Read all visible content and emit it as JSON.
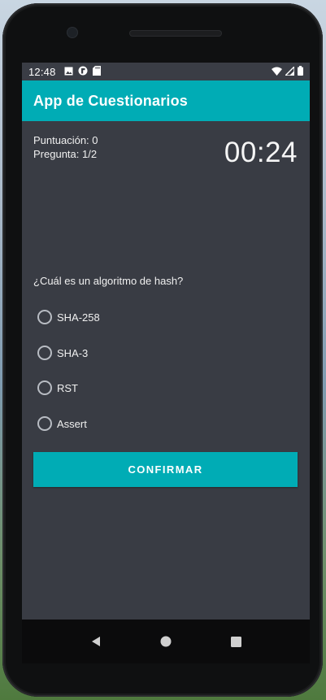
{
  "status_bar": {
    "time": "12:48",
    "left_icons": [
      "image-icon",
      "app-notification-icon",
      "sd-card-icon"
    ],
    "right_icons": [
      "wifi-icon",
      "signal-icon",
      "battery-icon"
    ]
  },
  "app_bar": {
    "title": "App de Cuestionarios"
  },
  "quiz": {
    "score_label": "Puntuación: 0",
    "question_counter": "Pregunta: 1/2",
    "timer": "00:24",
    "question": "¿Cuál es un algoritmo de hash?",
    "options": [
      "SHA-258",
      "SHA-3",
      "RST",
      "Assert"
    ],
    "confirm_label": "CONFIRMAR"
  },
  "navigation": {
    "icons": [
      "back-icon",
      "home-icon",
      "recents-icon"
    ]
  },
  "colors": {
    "accent": "#00acb5",
    "background": "#393c44",
    "status_bar": "#3a3d45"
  }
}
